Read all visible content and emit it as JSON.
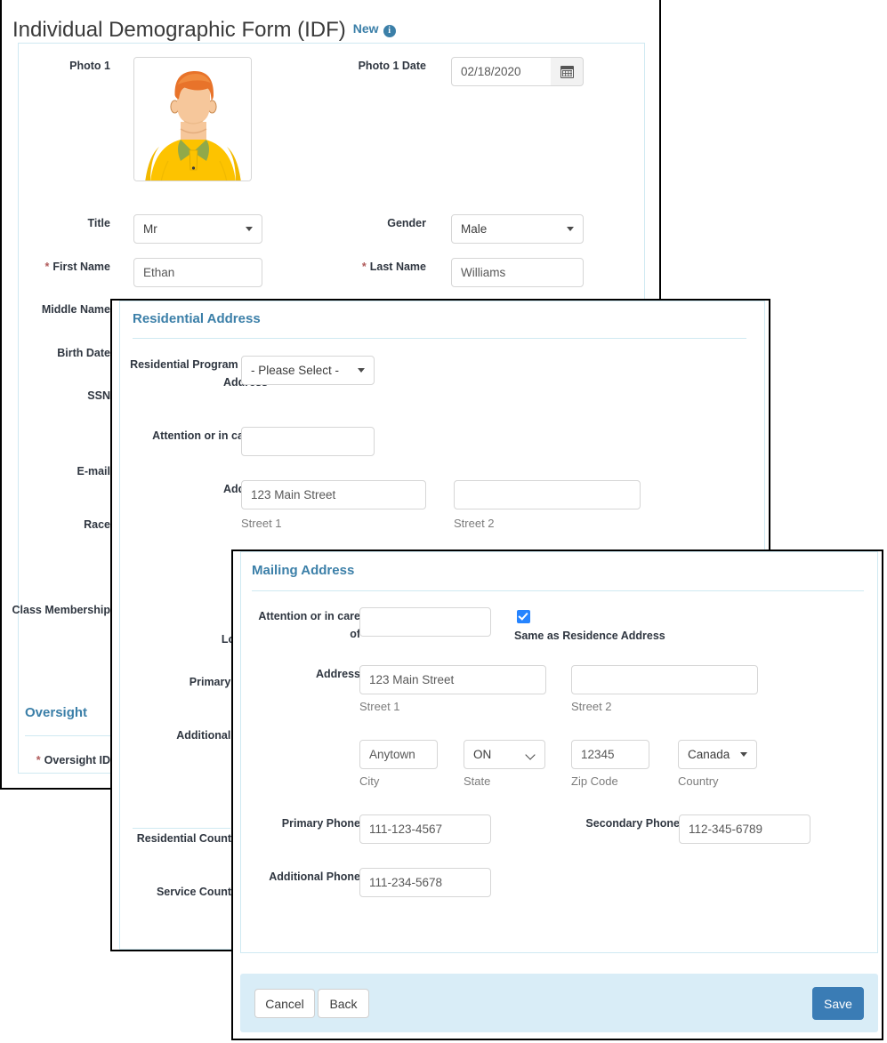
{
  "header": {
    "title": "Individual Demographic Form (IDF)",
    "status_badge": "New",
    "info_icon": "info-circle-icon"
  },
  "idf_panel": {
    "photo_label": "Photo 1",
    "photo_alt": "person-avatar-illustration",
    "photo_date_label": "Photo 1 Date",
    "photo_date_value": "02/18/2020",
    "calendar_icon": "calendar-icon",
    "title_label": "Title",
    "title_value": "Mr",
    "gender_label": "Gender",
    "gender_value": "Male",
    "first_name_label": "First Name",
    "first_name_required": "*",
    "first_name_value": "Ethan",
    "last_name_label": "Last Name",
    "last_name_required": "*",
    "last_name_value": "Williams",
    "side_labels": [
      "Middle Name",
      "Birth Date",
      "SSN",
      "E-mail",
      "Race",
      "Class Membership"
    ],
    "oversight_section_title": "Oversight",
    "oversight_id_label": "Oversight ID",
    "oversight_id_required": "*"
  },
  "residential_panel": {
    "section_title": "Residential Address",
    "program_label": "Residential Program / Site Address",
    "program_value": "- Please Select -",
    "attention_label": "Attention or in care of",
    "attention_value": "",
    "address_label": "Address",
    "street1_value": "123 Main Street",
    "street1_caption": "Street 1",
    "street2_value": "",
    "street2_caption": "Street 2",
    "location_label": "Location",
    "primary_phone_label": "Primary Phone",
    "additional_phone_label": "Additional Phone",
    "residential_county_state_label": "Residential County State",
    "service_county_state_label": "Service County State"
  },
  "mailing_panel": {
    "section_title": "Mailing Address",
    "attention_label": "Attention or in care of",
    "attention_value": "",
    "same_as_residence_label": "Same as Residence Address",
    "same_as_residence_checked": true,
    "address_label": "Address",
    "street1_value": "123 Main Street",
    "street1_caption": "Street 1",
    "street2_value": "",
    "street2_caption": "Street 2",
    "city_value": "Anytown",
    "city_caption": "City",
    "state_value": "ON",
    "state_caption": "State",
    "zip_value": "12345",
    "zip_caption": "Zip Code",
    "country_value": "Canada",
    "country_caption": "Country",
    "primary_phone_label": "Primary Phone",
    "primary_phone_value": "111-123-4567",
    "secondary_phone_label": "Secondary Phone",
    "secondary_phone_value": "112-345-6789",
    "additional_phone_label": "Additional Phone",
    "additional_phone_value": "111-234-5678"
  },
  "footer": {
    "cancel_label": "Cancel",
    "back_label": "Back",
    "save_label": "Save"
  },
  "colors": {
    "accent_blue": "#3b7fa8",
    "primary_button": "#3a7cb5",
    "checkbox_blue": "#2684ff",
    "footer_bar": "#d9edf7",
    "panel_inner_border": "#cfe9f2",
    "required_asterisk": "#b05a5a"
  }
}
